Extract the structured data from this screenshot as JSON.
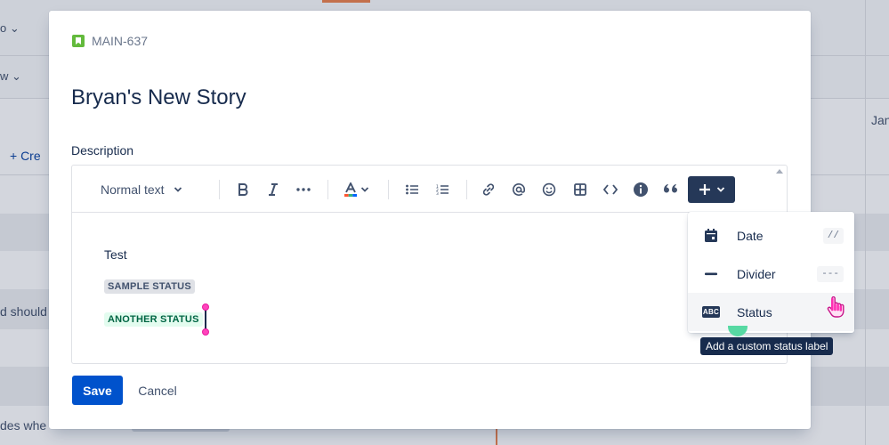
{
  "background": {
    "create_label": "+ Cre",
    "jan_label": "Jan",
    "row_fragment_1": "d should",
    "row_fragment_2": "des whe"
  },
  "issue": {
    "key": "MAIN-637",
    "title": "Bryan's New Story"
  },
  "description": {
    "label": "Description",
    "paragraph": "Test",
    "status_1": "SAMPLE STATUS",
    "status_2": "ANOTHER STATUS"
  },
  "toolbar": {
    "text_style": "Normal text",
    "icons": [
      "bold-icon",
      "italic-icon",
      "more-formatting-icon",
      "text-color-icon",
      "bullet-list-icon",
      "numbered-list-icon",
      "link-icon",
      "mention-icon",
      "emoji-icon",
      "table-icon",
      "code-icon",
      "info-panel-icon",
      "quote-icon",
      "insert-plus-icon"
    ]
  },
  "insert_menu": {
    "items": [
      {
        "label": "Date",
        "shortcut": "//",
        "icon": "calendar-icon"
      },
      {
        "label": "Divider",
        "shortcut": "---",
        "icon": "divider-icon"
      },
      {
        "label": "Status",
        "shortcut": "",
        "icon": "status-abc-icon"
      }
    ],
    "abc_text": "ABC",
    "tooltip": "Add a custom status label"
  },
  "actions": {
    "save": "Save",
    "cancel": "Cancel"
  },
  "colors": {
    "primary": "#0052cc",
    "story_green": "#63ba3c",
    "toolbar_dark": "#253858",
    "status_green_text": "#006644"
  }
}
